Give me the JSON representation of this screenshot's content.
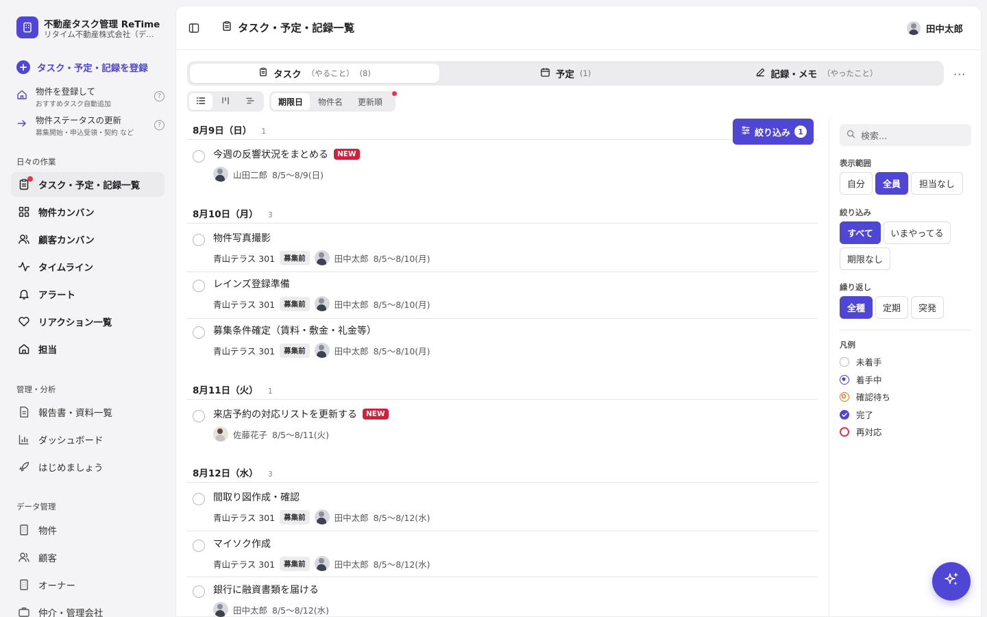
{
  "brand": {
    "title": "不動産タスク管理 ReTime",
    "subtitle": "リタイム不動産株式会社（デ…"
  },
  "sidebar": {
    "register_label": "タスク・予定・記録を登録",
    "quick": [
      {
        "title": "物件を登録して",
        "sub": "おすすめタスク自動追加"
      },
      {
        "title": "物件ステータスの更新",
        "sub": "募集開始・申込受領・契約 など"
      }
    ],
    "daily_label": "日々の作業",
    "daily_items": [
      "タスク・予定・記録一覧",
      "物件カンバン",
      "顧客カンバン",
      "タイムライン",
      "アラート",
      "リアクション一覧",
      "担当"
    ],
    "manage_label": "管理・分析",
    "manage_items": [
      "報告書・資料一覧",
      "ダッシュボード",
      "はじめましょう"
    ],
    "data_label": "データ管理",
    "data_items": [
      "物件",
      "顧客",
      "オーナー",
      "仲介・管理会社"
    ]
  },
  "header": {
    "title": "タスク・予定・記録一覧",
    "user": "田中太郎"
  },
  "tabs": [
    {
      "label": "タスク",
      "hint": "（やること）",
      "count": "(8)"
    },
    {
      "label": "予定",
      "hint": "",
      "count": "(1)"
    },
    {
      "label": "記録・メモ",
      "hint": "（やったこと）",
      "count": ""
    }
  ],
  "sort_options": [
    "期限日",
    "物件名",
    "更新順"
  ],
  "filter": {
    "label": "絞り込み",
    "count": "1"
  },
  "groups": [
    {
      "date": "8月9日（日）",
      "count": "1",
      "tasks": [
        {
          "title": "今週の反響状況をまとめる",
          "is_new": true,
          "property": "",
          "status": "",
          "assignee": "山田二郎",
          "period": "8/5〜8/9(日)"
        }
      ]
    },
    {
      "date": "8月10日（月）",
      "count": "3",
      "tasks": [
        {
          "title": "物件写真撮影",
          "is_new": false,
          "property": "青山テラス 301",
          "status": "募集前",
          "assignee": "田中太郎",
          "period": "8/5〜8/10(月)"
        },
        {
          "title": "レインズ登録準備",
          "is_new": false,
          "property": "青山テラス 301",
          "status": "募集前",
          "assignee": "田中太郎",
          "period": "8/5〜8/10(月)"
        },
        {
          "title": "募集条件確定（賃料・敷金・礼金等）",
          "is_new": false,
          "property": "青山テラス 301",
          "status": "募集前",
          "assignee": "田中太郎",
          "period": "8/5〜8/10(月)"
        }
      ]
    },
    {
      "date": "8月11日（火）",
      "count": "1",
      "tasks": [
        {
          "title": "来店予約の対応リストを更新する",
          "is_new": true,
          "property": "",
          "status": "",
          "assignee": "佐藤花子",
          "period": "8/5〜8/11(火)"
        }
      ]
    },
    {
      "date": "8月12日（水）",
      "count": "3",
      "tasks": [
        {
          "title": "間取り図作成・確認",
          "is_new": false,
          "property": "青山テラス 301",
          "status": "募集前",
          "assignee": "田中太郎",
          "period": "8/5〜8/12(水)"
        },
        {
          "title": "マイソク作成",
          "is_new": false,
          "property": "青山テラス 301",
          "status": "募集前",
          "assignee": "田中太郎",
          "period": "8/5〜8/12(水)"
        },
        {
          "title": "銀行に融資書類を届ける",
          "is_new": false,
          "property": "",
          "status": "",
          "assignee": "田中太郎",
          "period": "8/5〜8/12(水)"
        }
      ]
    }
  ],
  "new_badge": "NEW",
  "right_panel": {
    "search_placeholder": "検索...",
    "scope_label": "表示範囲",
    "scope_options": [
      "自分",
      "全員",
      "担当なし"
    ],
    "narrow_label": "絞り込み",
    "narrow_options": [
      "すべて",
      "いまやってる",
      "期限なし"
    ],
    "repeat_label": "繰り返し",
    "repeat_options": [
      "全種",
      "定期",
      "突発"
    ],
    "legend_label": "凡例",
    "legend": [
      "未着手",
      "着手中",
      "確認待ち",
      "完了",
      "再対応"
    ]
  },
  "colors": {
    "accent": "#4f46d6",
    "new_badge": "#d21f3c",
    "alert_dot": "#e5364d",
    "waiting": "#e8751a",
    "redo": "#e5364d"
  }
}
